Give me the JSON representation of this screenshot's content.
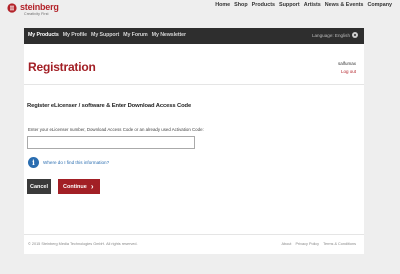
{
  "brand": {
    "name": "steinberg",
    "tagline": "Creativity First",
    "accent_color": "#b3232a"
  },
  "top_nav": [
    "Home",
    "Shop",
    "Products",
    "Support",
    "Artists",
    "News & Events",
    "Company"
  ],
  "user_nav": {
    "items": [
      "My Products",
      "My Profile",
      "My Support",
      "My Forum",
      "My Newsletter"
    ],
    "active_index": 0,
    "language_label": "Language: English",
    "language_icon": "gear-icon"
  },
  "page": {
    "title": "Registration",
    "username": "salfumax",
    "logout_label": "Log out"
  },
  "form": {
    "heading": "Register eLicenser / software & Enter Download Access Code",
    "field_label": "Enter your eLicenser number, Download Access Code or an already used Activation Code:",
    "field_value": "",
    "field_placeholder": "",
    "info_icon": "info-icon",
    "info_link": "Where do I find this information?",
    "cancel_label": "Cancel",
    "continue_label": "Continue"
  },
  "footer": {
    "copyright": "© 2015 Steinberg Media Technologies GmbH. All rights reserved.",
    "links": [
      "About",
      "Privacy Policy",
      "Terms & Conditions"
    ]
  }
}
